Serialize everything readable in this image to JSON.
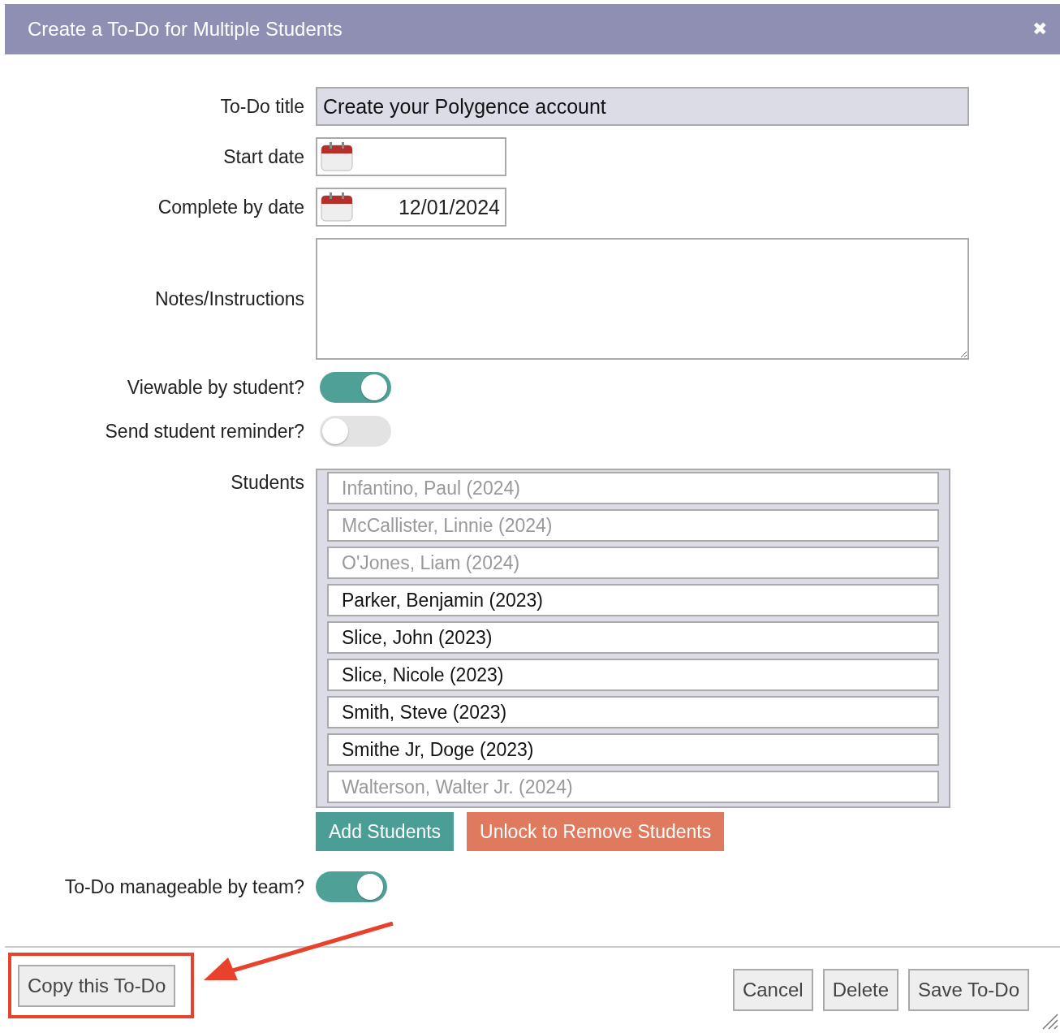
{
  "dialog": {
    "title": "Create a To-Do for Multiple Students",
    "close": "✖"
  },
  "fields": {
    "title": {
      "label": "To-Do title",
      "value": "Create your Polygence account"
    },
    "start_date": {
      "label": "Start date"
    },
    "complete_by": {
      "label": "Complete by date",
      "value": "12/01/2024"
    },
    "notes": {
      "label": "Notes/Instructions"
    },
    "viewable": {
      "label": "Viewable by student?",
      "on": true
    },
    "reminder": {
      "label": "Send student reminder?",
      "on": false
    }
  },
  "students": {
    "label": "Students",
    "items": [
      {
        "name": "Infantino, Paul (2024)",
        "disabled": true
      },
      {
        "name": "McCallister, Linnie (2024)",
        "disabled": true
      },
      {
        "name": "O'Jones, Liam (2024)",
        "disabled": true
      },
      {
        "name": "Parker, Benjamin (2023)",
        "disabled": false
      },
      {
        "name": "Slice, John (2023)",
        "disabled": false
      },
      {
        "name": "Slice, Nicole (2023)",
        "disabled": false
      },
      {
        "name": "Smith, Steve (2023)",
        "disabled": false
      },
      {
        "name": "Smithe Jr, Doge (2023)",
        "disabled": false
      },
      {
        "name": "Walterson, Walter Jr. (2024)",
        "disabled": true
      }
    ],
    "buttons": [
      {
        "label": "Add Students",
        "kind": "add"
      },
      {
        "label": "Unlock to Remove Students",
        "kind": "unlock"
      }
    ]
  },
  "manageable": {
    "label": "To-Do manageable by team?",
    "on": true
  },
  "footer": {
    "copy": "Copy this To-Do",
    "buttons": [
      "Cancel",
      "Delete",
      "Save To-Do"
    ]
  }
}
